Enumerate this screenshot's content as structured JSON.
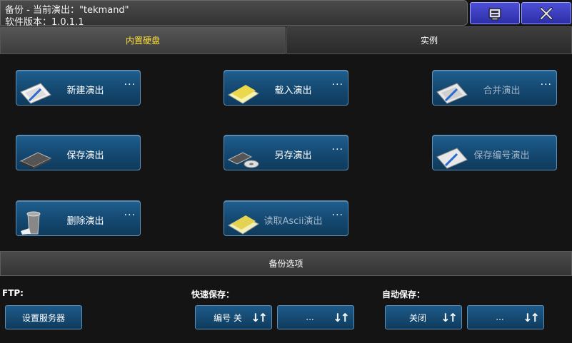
{
  "window": {
    "title_line1": "备份 - 当前演出：\"tekmand\"",
    "title_line2": "软件版本：1.0.1.1",
    "minimize_icon": "window-restore-icon",
    "close_icon": "close-icon",
    "accent": "#3a3cc4"
  },
  "tabs": [
    {
      "label": "内置硬盘",
      "active": true
    },
    {
      "label": "实例",
      "active": false
    }
  ],
  "actions": {
    "new_show": {
      "label": "新建演出",
      "dots": "···",
      "icon": "new-document-icon"
    },
    "load_show": {
      "label": "载入演出",
      "dots": "···",
      "icon": "folder-icon"
    },
    "merge_show": {
      "label": "合并演出",
      "dots": "···",
      "icon": "merge-icon",
      "disabled": true
    },
    "save_show": {
      "label": "保存演出",
      "icon": "hard-drive-icon"
    },
    "save_as": {
      "label": "另存演出",
      "dots": "···",
      "icon": "save-as-disk-icon"
    },
    "save_numbered": {
      "label": "保存编号演出",
      "icon": "save-numbered-icon",
      "disabled": true
    },
    "delete_show": {
      "label": "删除演出",
      "dots": "···",
      "icon": "trash-icon"
    },
    "read_ascii": {
      "label": "读取Ascii演出",
      "dots": "···",
      "icon": "ascii-folder-icon",
      "disabled": true
    }
  },
  "backup_options": {
    "title": "备份选项",
    "ftp": {
      "label": "FTP:",
      "button": "设置服务器"
    },
    "quick_save": {
      "label": "快速保存：",
      "value": "编号 关",
      "more": "..."
    },
    "auto_save": {
      "label": "自动保存：",
      "value": "关闭",
      "more": "..."
    }
  },
  "sort_glyph": "↓↑"
}
